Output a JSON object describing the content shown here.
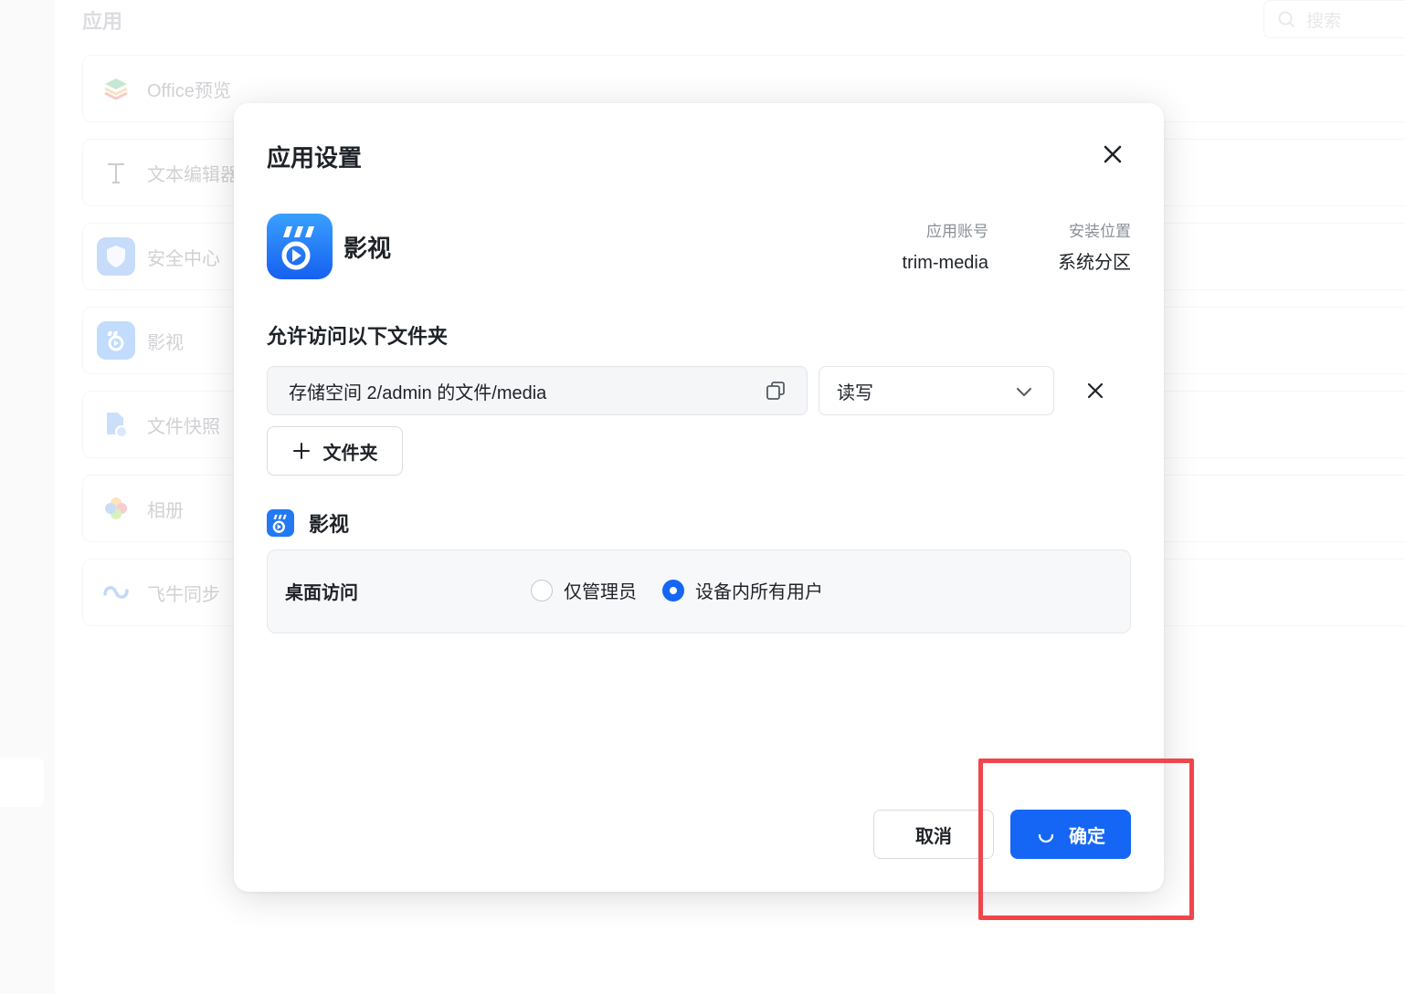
{
  "background": {
    "title": "应用",
    "search_placeholder": "搜索",
    "apps": [
      {
        "label": "Office预览",
        "icon": "office-preview-icon"
      },
      {
        "label": "文本编辑器",
        "icon": "text-editor-icon"
      },
      {
        "label": "安全中心",
        "icon": "security-center-icon"
      },
      {
        "label": "影视",
        "icon": "media-app-icon"
      },
      {
        "label": "文件快照",
        "icon": "file-snapshot-icon"
      },
      {
        "label": "相册",
        "icon": "photos-icon"
      },
      {
        "label": "飞牛同步",
        "icon": "sync-icon"
      }
    ]
  },
  "dialog": {
    "title": "应用设置",
    "app": {
      "name": "影视",
      "account_label": "应用账号",
      "account_value": "trim-media",
      "location_label": "安装位置",
      "location_value": "系统分区"
    },
    "folders": {
      "title": "允许访问以下文件夹",
      "items": [
        {
          "path": "存储空间 2/admin 的文件/media",
          "permission": "读写"
        }
      ],
      "add_label": "文件夹"
    },
    "access": {
      "section_title": "影视",
      "label": "桌面访问",
      "options": [
        "仅管理员",
        "设备内所有用户"
      ],
      "selected": "设备内所有用户"
    },
    "buttons": {
      "cancel": "取消",
      "ok": "确定"
    }
  },
  "colors": {
    "primary": "#1566f5",
    "highlight": "#f0454b"
  }
}
